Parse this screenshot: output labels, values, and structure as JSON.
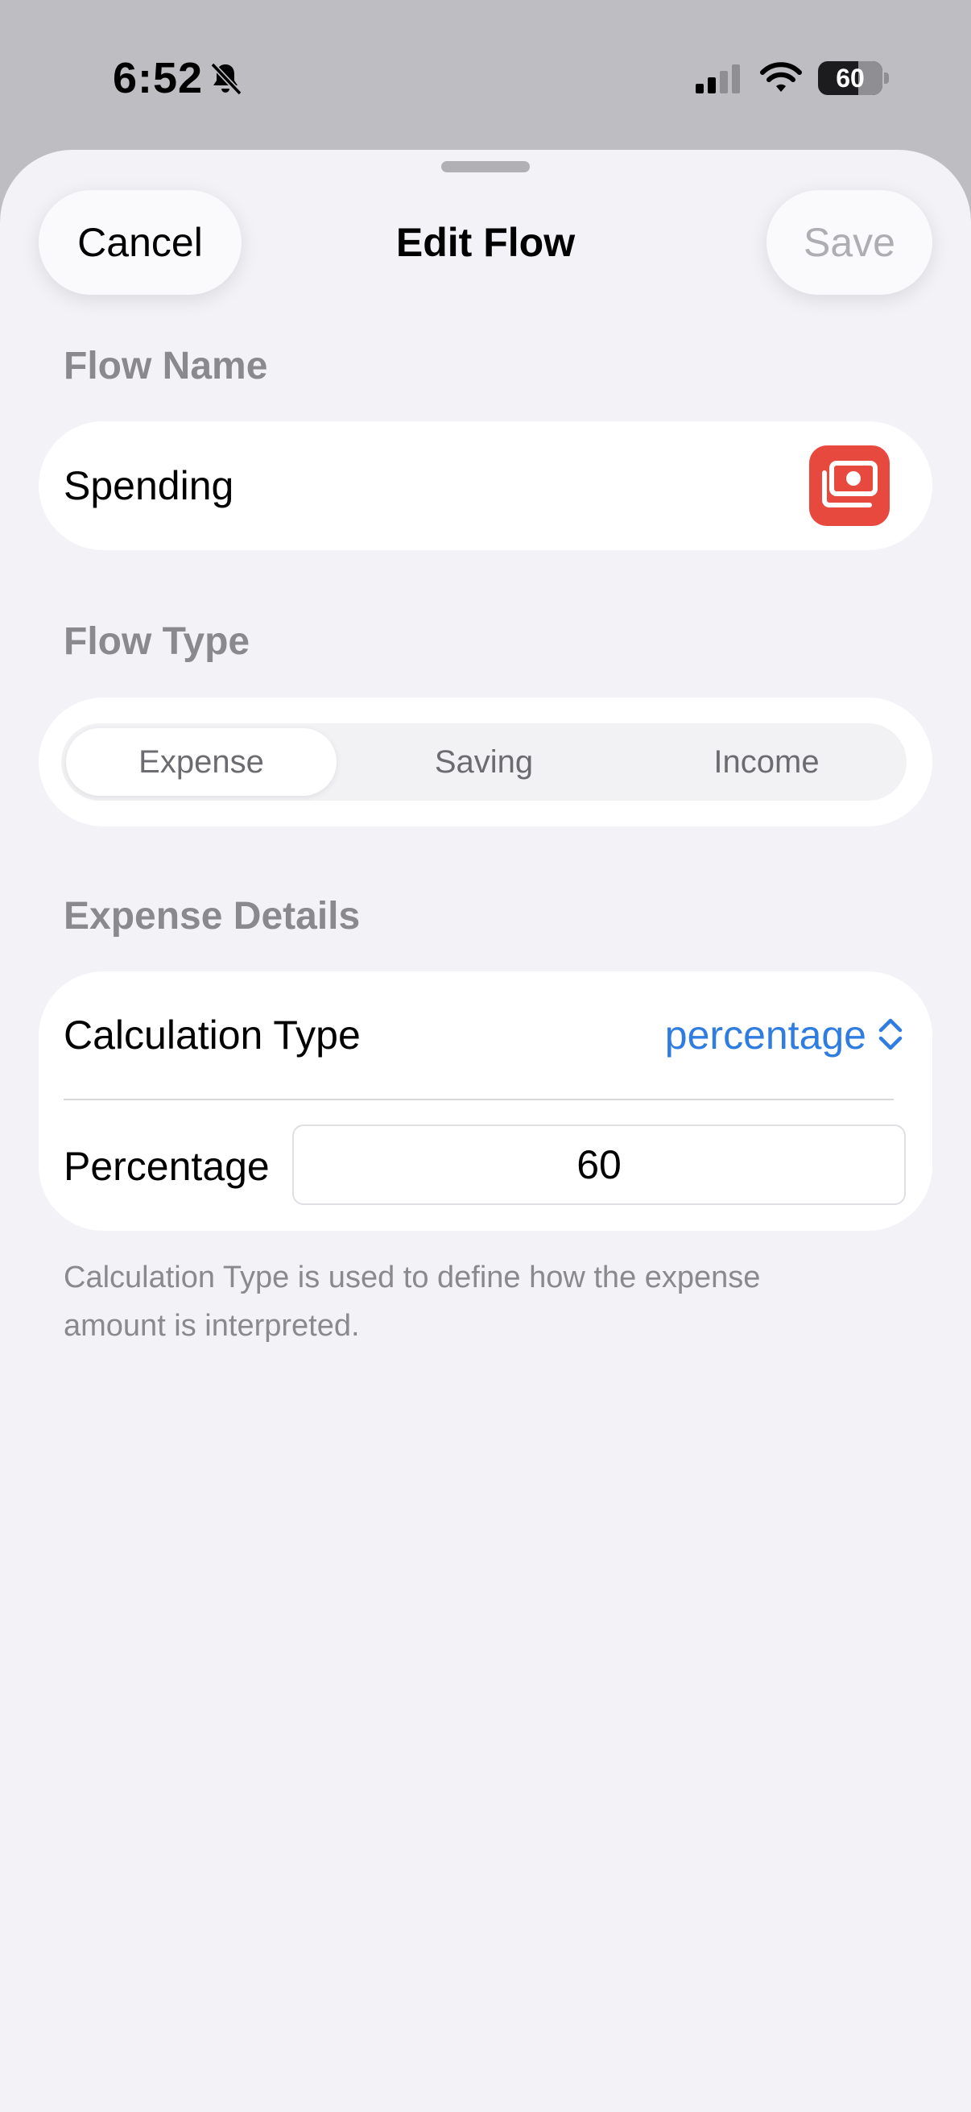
{
  "status_bar": {
    "time": "6:52",
    "battery_level": "60",
    "icons": [
      "bell-slash-icon",
      "cellular-signal-icon",
      "wifi-icon",
      "battery-icon"
    ]
  },
  "nav": {
    "cancel_label": "Cancel",
    "title": "Edit Flow",
    "save_label": "Save"
  },
  "flow_name": {
    "header": "Flow Name",
    "value": "Spending",
    "icon": "banknote-icon",
    "icon_color": "#e8493f"
  },
  "flow_type": {
    "header": "Flow Type",
    "options": [
      "Expense",
      "Saving",
      "Income"
    ],
    "selected": "Expense"
  },
  "expense_details": {
    "header": "Expense Details",
    "calculation_type_label": "Calculation Type",
    "calculation_type_value": "percentage",
    "percentage_label": "Percentage",
    "percentage_value": "60",
    "footer": "Calculation Type is used to define how the expense amount is interpreted."
  },
  "colors": {
    "accent": "#2f7de1",
    "background": "#f2f2f7",
    "secondary_text": "#8a8a8e"
  }
}
